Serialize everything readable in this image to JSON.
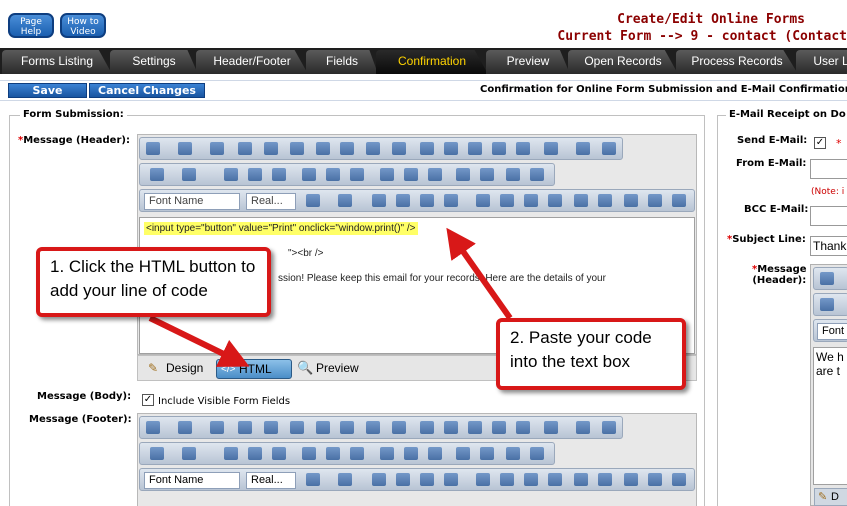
{
  "top_buttons": {
    "help": "Page Help",
    "video": "How to Video"
  },
  "header": {
    "title": "Create/Edit Online Forms",
    "current_form": "Current Form --> 9 - contact (Contact"
  },
  "tabs": [
    {
      "label": "Forms Listing"
    },
    {
      "label": "Settings"
    },
    {
      "label": "Header/Footer"
    },
    {
      "label": "Fields"
    },
    {
      "label": "Confirmation"
    },
    {
      "label": "Preview"
    },
    {
      "label": "Open Records"
    },
    {
      "label": "Process Records"
    },
    {
      "label": "User L"
    }
  ],
  "toolbar": {
    "save_label": "Save",
    "cancel_label": "Cancel Changes",
    "section_title": "Confirmation for Online Form Submission and E-Mail Confirmation"
  },
  "left": {
    "legend": "Form Submission:",
    "message_header_label": "Message (Header):",
    "font_name": "Font Name",
    "font_size": "Real...",
    "code_line": "<input type=\"button\" value=\"Print\" onclick=\"window.print()\" />",
    "body_fragment_1": "\"><br />",
    "body_fragment_2": "ssion! Please keep this email for your records. Here are the details of your",
    "modes": {
      "design": "Design",
      "html": "HTML",
      "preview": "Preview"
    },
    "message_body_label": "Message (Body):",
    "include_visible": "Include Visible Form Fields",
    "message_footer_label": "Message (Footer):",
    "footer_font_name": "Font Name",
    "footer_font_size": "Real..."
  },
  "callouts": {
    "one": "1. Click the HTML button to add your line of code",
    "two": "2. Paste your code into the text box"
  },
  "right": {
    "legend": "E-Mail Receipt on Do",
    "send_email_label": "Send E-Mail:",
    "from_email_label": "From E-Mail:",
    "note": "(Note: i",
    "bcc_email_label": "BCC E-Mail:",
    "subject_label": "Subject Line:",
    "subject_value": "Thank",
    "message_header_label_1": "Message",
    "message_header_label_2": "(Header):",
    "font_name": "Font",
    "preview_text_1": "We h",
    "preview_text_2": "are t",
    "design_label": "D"
  }
}
